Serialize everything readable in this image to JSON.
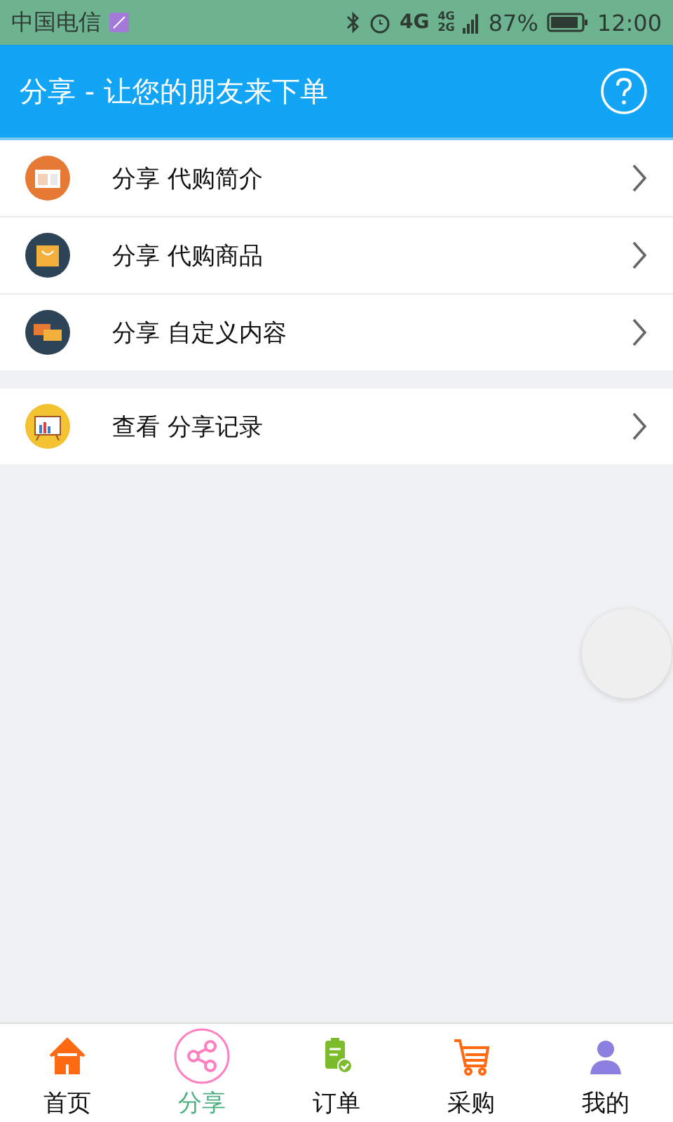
{
  "status_bar": {
    "carrier": "中国电信",
    "network": "4G",
    "network_small": [
      "4G",
      "2G"
    ],
    "battery": "87%",
    "time": "12:00"
  },
  "header": {
    "title": "分享 - 让您的朋友来下单"
  },
  "groups": [
    {
      "items": [
        {
          "kind": "article",
          "label": "分享 代购简介"
        },
        {
          "kind": "bag",
          "label": "分享 代购商品"
        },
        {
          "kind": "chat",
          "label": "分享 自定义内容"
        }
      ]
    },
    {
      "items": [
        {
          "kind": "board",
          "label": "查看 分享记录"
        }
      ]
    }
  ],
  "bottom_nav": [
    {
      "kind": "home",
      "label": "首页",
      "selected": false
    },
    {
      "kind": "share",
      "label": "分享",
      "selected": true
    },
    {
      "kind": "order",
      "label": "订单",
      "selected": false
    },
    {
      "kind": "cart",
      "label": "采购",
      "selected": false
    },
    {
      "kind": "user",
      "label": "我的",
      "selected": false
    }
  ]
}
